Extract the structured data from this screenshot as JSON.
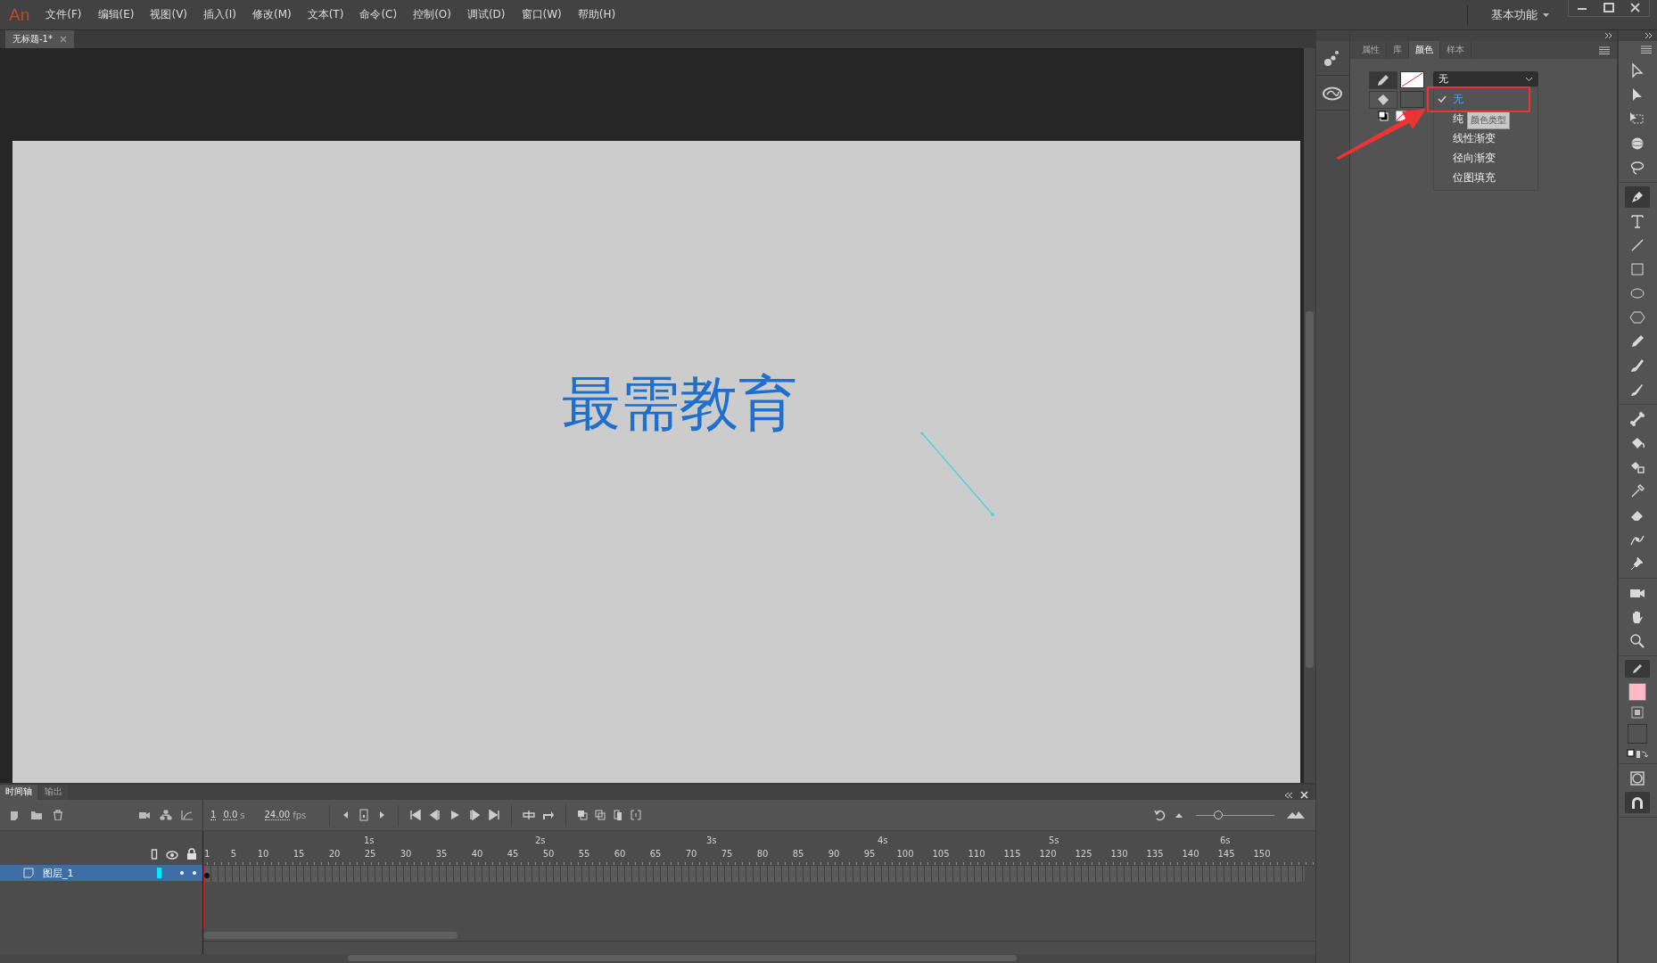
{
  "app": {
    "logo": "An"
  },
  "menu": [
    "文件(F)",
    "编辑(E)",
    "视图(V)",
    "插入(I)",
    "修改(M)",
    "文本(T)",
    "命令(C)",
    "控制(O)",
    "调试(D)",
    "窗口(W)",
    "帮助(H)"
  ],
  "workspace": {
    "label": "基本功能"
  },
  "document_tabs": [
    {
      "title": "无标题-1*",
      "selected": true
    }
  ],
  "stage": {
    "text": "最需教育"
  },
  "panel_tabs": [
    {
      "label": "属性",
      "selected": false
    },
    {
      "label": "库",
      "selected": false
    },
    {
      "label": "颜色",
      "selected": true
    },
    {
      "label": "样本",
      "selected": false
    }
  ],
  "color_type": {
    "value": "无",
    "tooltip": "颜色类型",
    "options": [
      {
        "label": "无",
        "selected": true
      },
      {
        "label": "纯",
        "selected": false
      },
      {
        "label": "线性渐变",
        "selected": false
      },
      {
        "label": "径向渐变",
        "selected": false
      },
      {
        "label": "位图填充",
        "selected": false
      }
    ]
  },
  "tool_groups": [
    {
      "tools": [
        {
          "kind": "arrow",
          "selected": false
        },
        {
          "kind": "subselect",
          "selected": false
        },
        {
          "kind": "transform",
          "selected": false
        },
        {
          "kind": "sphere",
          "selected": false
        },
        {
          "kind": "lasso",
          "selected": false
        }
      ]
    },
    {
      "tools": [
        {
          "kind": "pen",
          "selected": true
        },
        {
          "kind": "text",
          "selected": false
        },
        {
          "kind": "line",
          "selected": false
        },
        {
          "kind": "rect",
          "selected": false
        },
        {
          "kind": "oval",
          "selected": false
        },
        {
          "kind": "hexagon",
          "selected": false
        },
        {
          "kind": "pencil",
          "selected": false
        },
        {
          "kind": "brush",
          "selected": false
        },
        {
          "kind": "paintbrush",
          "selected": false
        }
      ]
    },
    {
      "tools": [
        {
          "kind": "bone",
          "selected": false
        },
        {
          "kind": "bucket",
          "selected": false
        },
        {
          "kind": "inkbottle",
          "selected": false
        },
        {
          "kind": "eyedropper",
          "selected": false
        },
        {
          "kind": "eraser",
          "selected": false
        },
        {
          "kind": "width",
          "selected": false
        },
        {
          "kind": "pin",
          "selected": false
        }
      ]
    },
    {
      "tools": [
        {
          "kind": "camera",
          "selected": false
        },
        {
          "kind": "hand",
          "selected": false
        },
        {
          "kind": "zoom",
          "selected": false
        }
      ]
    }
  ],
  "timeline": {
    "tabs": [
      {
        "label": "时间轴",
        "selected": true
      },
      {
        "label": "输出",
        "selected": false
      }
    ],
    "current_frame": "1",
    "time": "0.0",
    "time_unit": "s",
    "fps": "24.00",
    "fps_unit": "fps",
    "zoom": {
      "level": 0.28
    },
    "seconds": [
      "1s",
      "2s",
      "3s",
      "4s",
      "5s",
      "6s"
    ],
    "frame_numbers": [
      "1",
      "5",
      "10",
      "15",
      "20",
      "25",
      "30",
      "35",
      "40",
      "45",
      "50",
      "55",
      "60",
      "65",
      "70",
      "75",
      "80",
      "85",
      "90",
      "95",
      "100",
      "105",
      "110",
      "115",
      "120",
      "125",
      "130",
      "135",
      "140",
      "145",
      "150"
    ],
    "layers": [
      {
        "name": "图层_1",
        "selected": true,
        "color": "#00eaff"
      }
    ]
  }
}
